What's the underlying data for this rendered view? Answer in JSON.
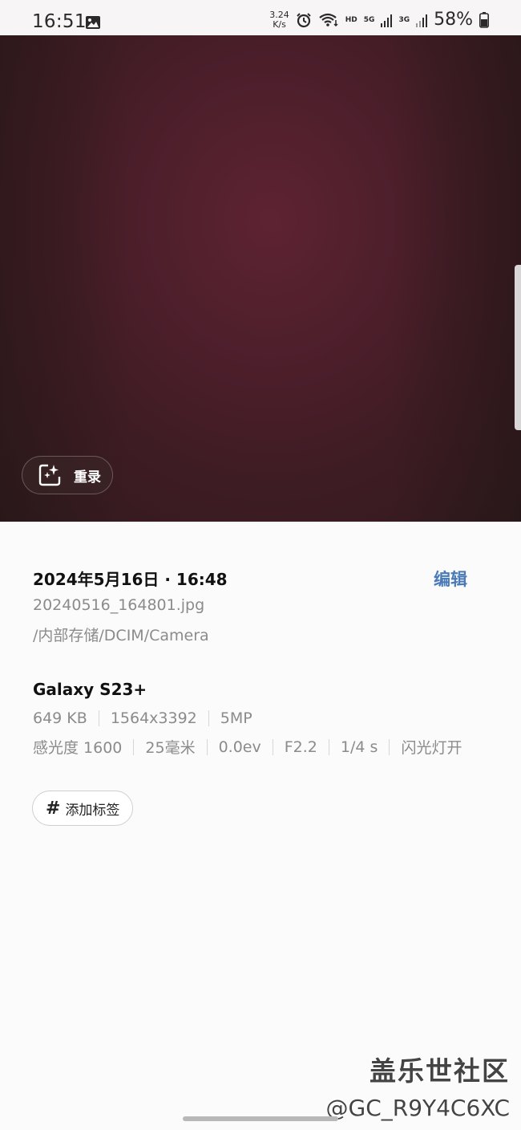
{
  "status_bar": {
    "time": "16:51",
    "net_speed_value": "3.24",
    "net_speed_unit": "K/s",
    "hd_label": "HD",
    "sig1_label": "5G",
    "sig2_label": "3G",
    "battery": "58%"
  },
  "photo": {
    "remaster_label": "重录"
  },
  "details": {
    "datetime": "2024年5月16日 · 16:48",
    "edit_label": "编辑",
    "filename": "20240516_164801.jpg",
    "path": "/内部存储/DCIM/Camera",
    "device": "Galaxy S23+",
    "file_size": "649 KB",
    "resolution": "1564x3392",
    "megapixels": "5MP",
    "iso": "感光度 1600",
    "focal_length": "25毫米",
    "exposure_value": "0.0ev",
    "aperture": "F2.2",
    "shutter": "1/4 s",
    "flash": "闪光灯开",
    "add_tag_hash": "#",
    "add_tag_label": "添加标签"
  },
  "watermark": {
    "line1": "盖乐世社区",
    "line2": "@GC_R9Y4C6XC"
  }
}
